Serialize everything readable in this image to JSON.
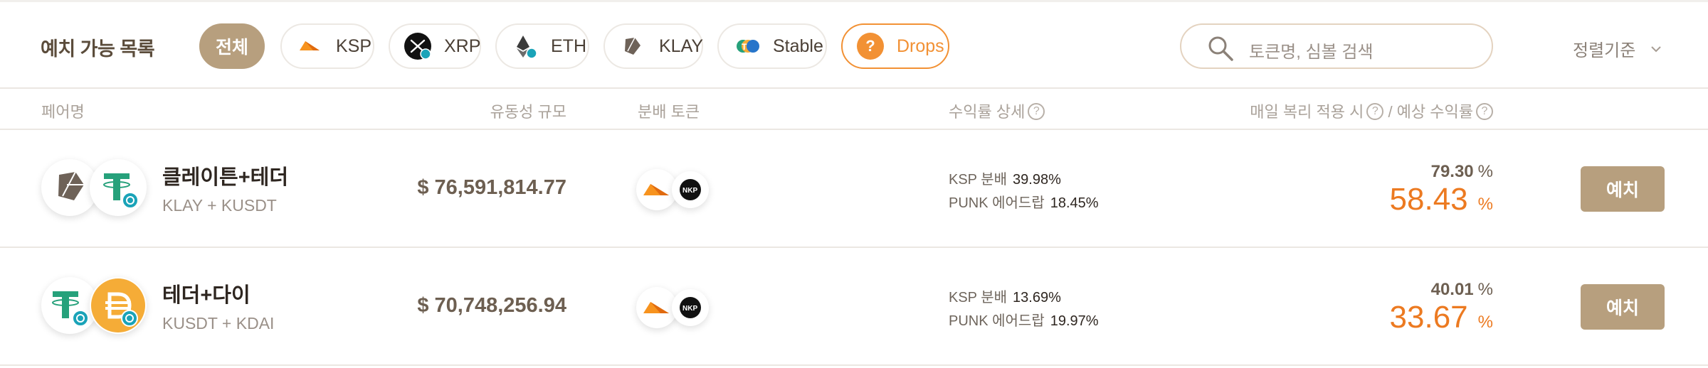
{
  "filters": {
    "title": "예치 가능 목록",
    "chips": [
      {
        "label": "전체",
        "icon": "none",
        "active": true
      },
      {
        "label": "KSP",
        "icon": "ksp-icon"
      },
      {
        "label": "XRP",
        "icon": "xrp-icon"
      },
      {
        "label": "ETH",
        "icon": "eth-icon"
      },
      {
        "label": "KLAY",
        "icon": "klay-icon"
      },
      {
        "label": "Stable",
        "icon": "stable-icon"
      },
      {
        "label": "Drops",
        "icon": "question-icon",
        "accent": "#f29134"
      }
    ],
    "search_placeholder": "토큰명, 심볼 검색",
    "sort_label": "정렬기준"
  },
  "columns": {
    "pair": "페어명",
    "liquidity": "유동성 규모",
    "distribution": "분배 토큰",
    "yield_detail": "수익률 상세",
    "apy_prefix": "매일 복리 적용 시",
    "apy_suffix": "/ 예상 수익률",
    "help_glyph": "?"
  },
  "rows": [
    {
      "name": "클레이튼+테더",
      "symbols": "KLAY + KUSDT",
      "token_icons": [
        "klay-icon",
        "tether-icon"
      ],
      "liquidity": "$ 76,591,814.77",
      "distribution_icons": [
        "ksp-icon",
        "punk-icon"
      ],
      "yields": [
        {
          "label": "KSP 분배",
          "value": "39.98%"
        },
        {
          "label": "PUNK 에어드랍",
          "value": "18.45%"
        }
      ],
      "apr": "79.30",
      "apy": "58.43",
      "percent_sign": "%",
      "deposit_label": "예치"
    },
    {
      "name": "테더+다이",
      "symbols": "KUSDT + KDAI",
      "token_icons": [
        "tether-icon",
        "dai-icon"
      ],
      "liquidity": "$ 70,748,256.94",
      "distribution_icons": [
        "ksp-icon",
        "punk-icon"
      ],
      "yields": [
        {
          "label": "KSP 분배",
          "value": "13.69%"
        },
        {
          "label": "PUNK 에어드랍",
          "value": "19.97%"
        }
      ],
      "apr": "40.01",
      "apy": "33.67",
      "percent_sign": "%",
      "deposit_label": "예치"
    }
  ],
  "colors": {
    "brand": "#b79f7e",
    "accent_orange": "#ec7a21",
    "drops_orange": "#f29134",
    "tether_green": "#26a17b",
    "dai_yellow": "#f5ac37"
  }
}
